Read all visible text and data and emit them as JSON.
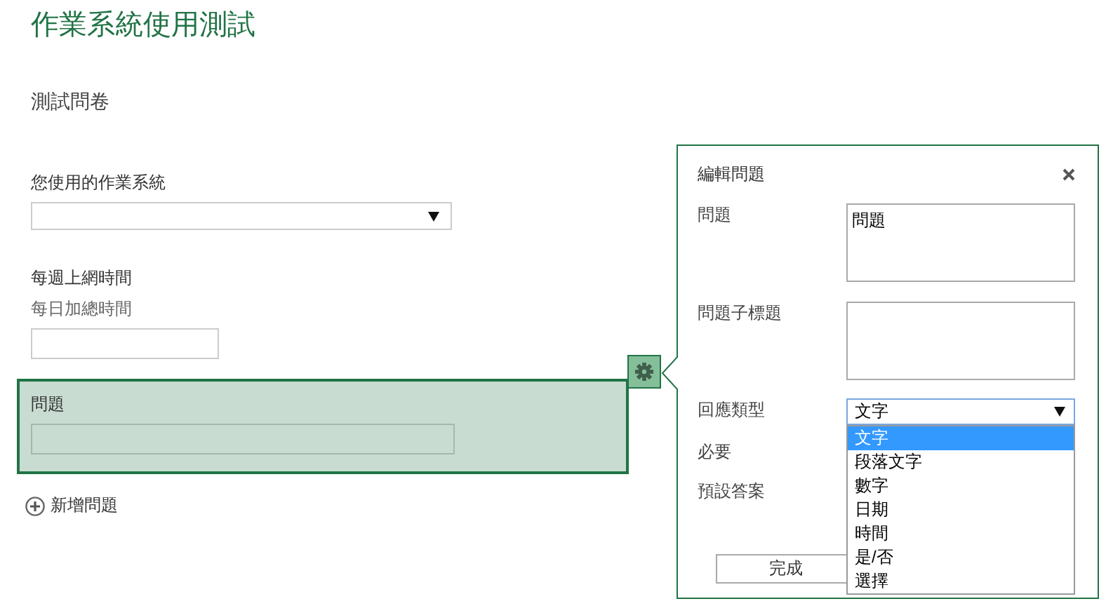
{
  "page": {
    "title": "作業系統使用測試",
    "form_title": "測試問卷"
  },
  "questions": [
    {
      "kind": "dropdown",
      "label": "您使用的作業系統",
      "selected": false
    },
    {
      "kind": "text",
      "label": "每週上網時間",
      "subtitle": "每日加總時間",
      "selected": false
    },
    {
      "kind": "wide_text",
      "label": "問題",
      "selected": true
    }
  ],
  "add_question": "新增問題",
  "editor": {
    "title": "編輯問題",
    "done": "完成",
    "fields": [
      {
        "kind": "textarea",
        "label": "問題",
        "value": "問題"
      },
      {
        "kind": "textarea",
        "label": "問題子標題"
      },
      {
        "kind": "select",
        "label": "回應類型",
        "value": "文字",
        "expanded": true,
        "options": [
          {
            "label": "文字",
            "selected": true
          },
          {
            "label": "段落文字",
            "selected": false
          },
          {
            "label": "數字",
            "selected": false
          },
          {
            "label": "日期",
            "selected": false
          },
          {
            "label": "時間",
            "selected": false
          },
          {
            "label": "是/否",
            "selected": false
          },
          {
            "label": "選擇",
            "selected": false
          }
        ]
      },
      {
        "kind": "plain",
        "label": "必要"
      },
      {
        "kind": "plain",
        "label": "預設答案"
      }
    ]
  }
}
